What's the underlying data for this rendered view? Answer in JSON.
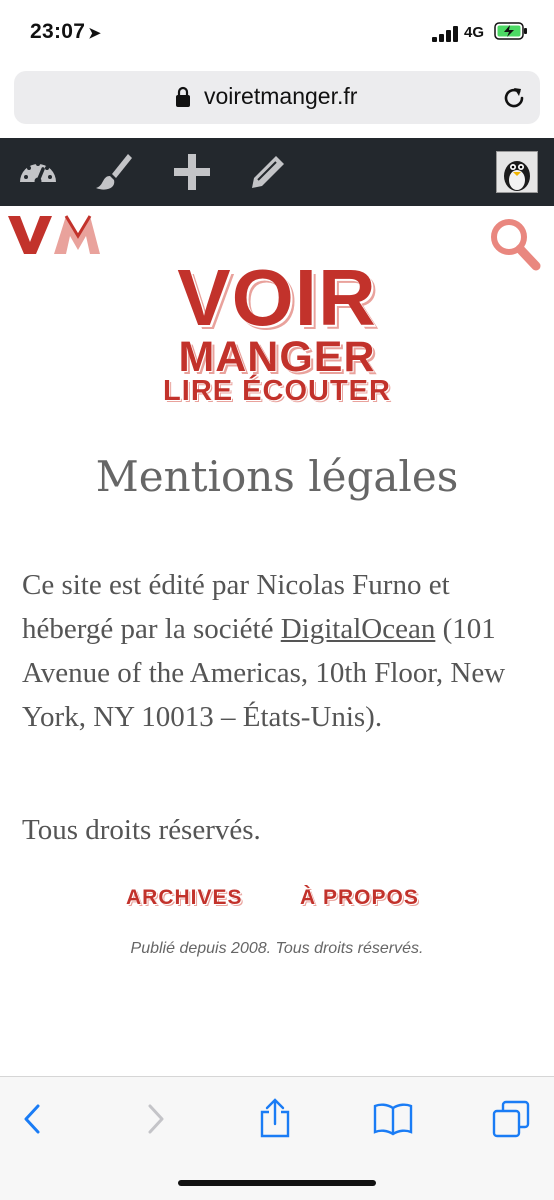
{
  "status_bar": {
    "time": "23:07",
    "location_arrow": "location-arrow-icon",
    "network": "4G"
  },
  "browser": {
    "url": "voiretmanger.fr"
  },
  "admin_bar": {
    "icons": [
      "dashboard-icon",
      "customize-brush-icon",
      "new-post-plus-icon",
      "edit-pencil-icon"
    ],
    "avatar": "penguin-avatar"
  },
  "site": {
    "logo": {
      "line1": "VOIR",
      "line2": "MANGER",
      "line3": "LIRE ÉCOUTER"
    },
    "brand_color": "#c2322b"
  },
  "page": {
    "title": "Mentions légales",
    "para1_before": "Ce site est édité par Nicolas Furno et hébergé par la société ",
    "para1_link": "DigitalOcean",
    "para1_after": " (101 Avenue of the Americas, 10th Floor, New York, NY 10013 – États-Unis).",
    "para2": "Tous droits réservés."
  },
  "footer": {
    "archives": "ARCHIVES",
    "apropos": "À PROPOS",
    "credit": "Publié depuis 2008. Tous droits réservés."
  },
  "toolbar": {
    "icons": [
      "back-icon",
      "forward-icon",
      "share-icon",
      "bookmarks-icon",
      "tabs-icon"
    ]
  },
  "colors": {
    "accent_ios": "#1a7cf5",
    "admin_bar": "#23282d"
  }
}
